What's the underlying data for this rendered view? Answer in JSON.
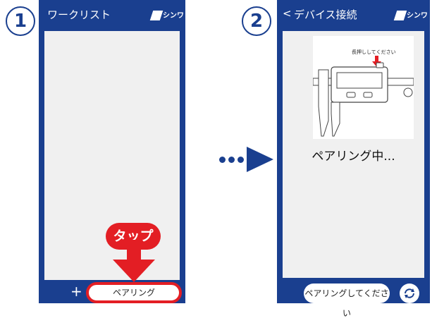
{
  "step1": {
    "number": "1",
    "header_title": "ワークリスト",
    "logo_text": "シンワ",
    "add_label": "+",
    "pairing_button_label": "ペアリング",
    "tap_label": "タップ"
  },
  "step2": {
    "number": "2",
    "header_back": "<",
    "header_title": "デバイス接続",
    "logo_text": "シンワ",
    "instruction_label": "長押ししてください",
    "status_text": "ペアリング中...",
    "pair_hint_button": "ペアリングしてください"
  },
  "colors": {
    "brand_blue": "#1a3f8f",
    "accent_red": "#e31e24",
    "screen_bg": "#f0f0f0"
  },
  "icons": [
    "step-1-badge",
    "step-2-badge",
    "shinwa-logo",
    "arrow-down-icon",
    "arrow-right-icon",
    "refresh-icon",
    "caliper-illustration"
  ]
}
